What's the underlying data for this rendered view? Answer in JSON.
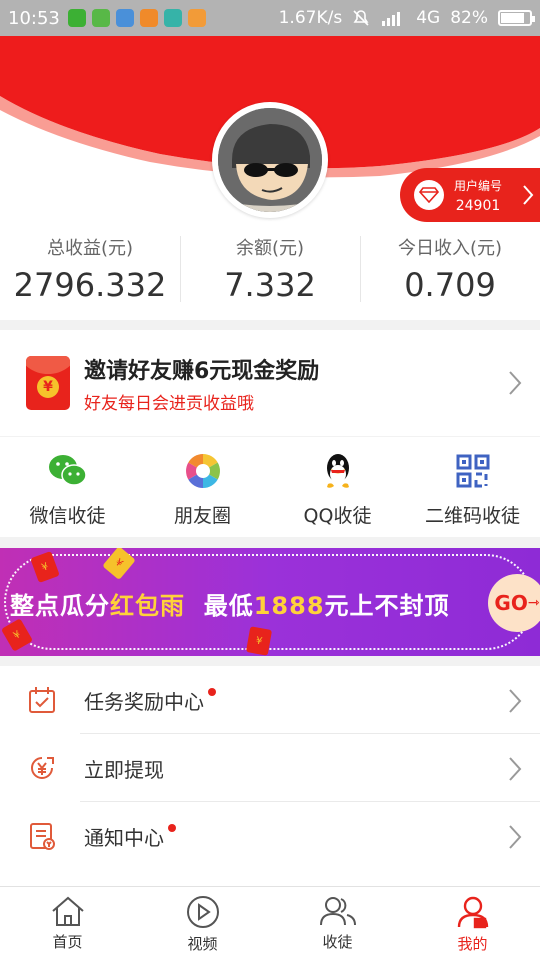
{
  "status_bar": {
    "time": "10:53",
    "network_speed": "1.67K/s",
    "network_type": "4G",
    "battery": "82%",
    "battery_level": 0.82
  },
  "profile": {
    "user_id_label": "用户编号",
    "user_id": "24901"
  },
  "stats": [
    {
      "label": "总收益(元)",
      "value": "2796.332"
    },
    {
      "label": "余额(元)",
      "value": "7.332"
    },
    {
      "label": "今日收入(元)",
      "value": "0.709"
    }
  ],
  "invite": {
    "title": "邀请好友赚6元现金奖励",
    "subtitle": "好友每日会进贡收益哦",
    "icon_glyph": "¥"
  },
  "share": [
    {
      "label": "微信收徒",
      "icon": "wechat-icon"
    },
    {
      "label": "朋友圈",
      "icon": "moments-icon"
    },
    {
      "label": "QQ收徒",
      "icon": "qq-icon"
    },
    {
      "label": "二维码收徒",
      "icon": "qrcode-icon"
    }
  ],
  "banner": {
    "part1": "整点瓜分",
    "part2": "红包雨",
    "part3": "最低",
    "part4": "1888",
    "part5": "元上不封顶",
    "go": "GO"
  },
  "menu": [
    {
      "label": "任务奖励中心",
      "dot": true,
      "icon": "calendar-icon"
    },
    {
      "label": "立即提现",
      "dot": false,
      "icon": "yuan-coin-icon"
    },
    {
      "label": "通知中心",
      "dot": true,
      "icon": "notice-icon"
    }
  ],
  "tabbar": [
    {
      "label": "首页",
      "icon": "home-icon",
      "active": false
    },
    {
      "label": "视频",
      "icon": "video-icon",
      "active": false
    },
    {
      "label": "收徒",
      "icon": "disciples-icon",
      "active": false
    },
    {
      "label": "我的",
      "icon": "profile-icon",
      "active": true
    }
  ],
  "colors": {
    "accent": "#e8231c",
    "banner_yellow": "#ffd23a",
    "wechat_green": "#3cb034"
  }
}
